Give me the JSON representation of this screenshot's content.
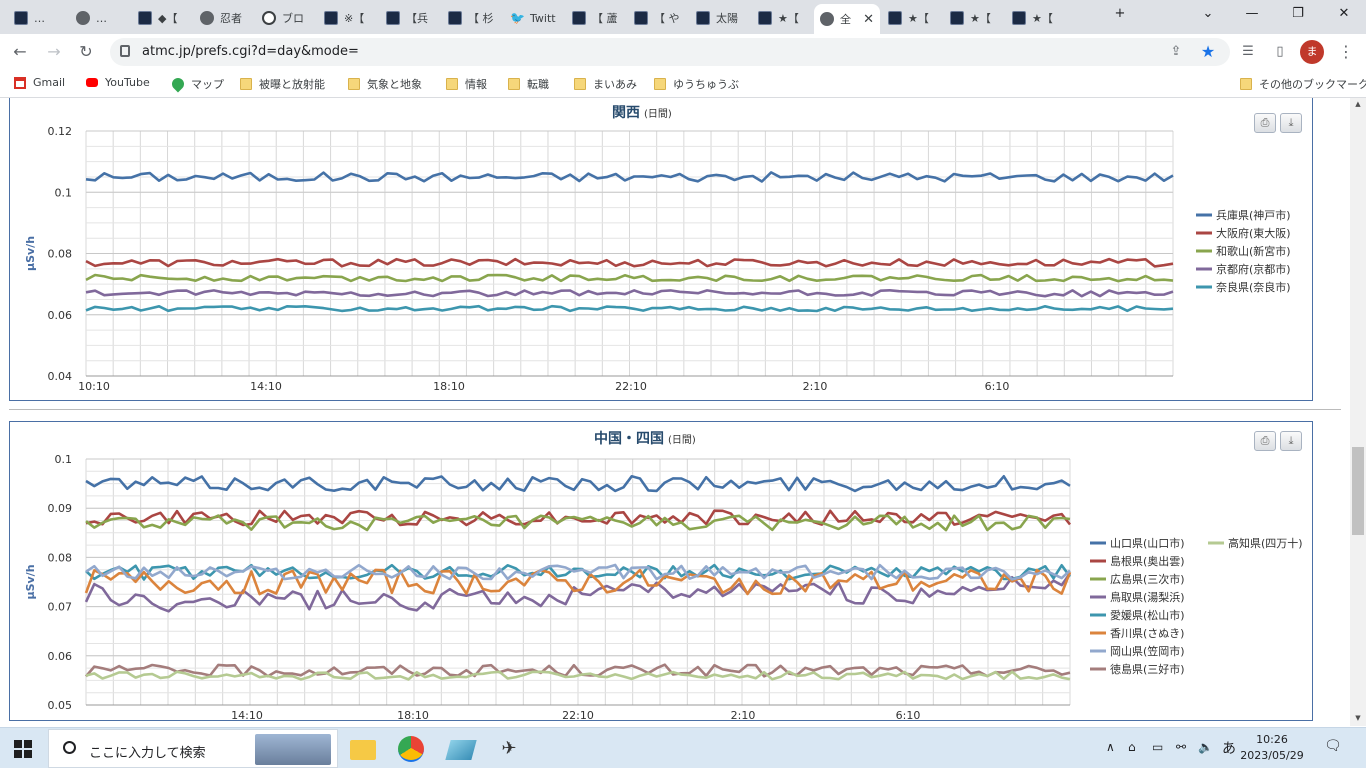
{
  "browser": {
    "tabs": [
      {
        "label": "…",
        "icon": "site-favicon",
        "active": false
      },
      {
        "label": "…",
        "icon": "globe-icon",
        "active": false
      },
      {
        "label": "◆【",
        "icon": "site-favicon",
        "active": false
      },
      {
        "label": "忍者",
        "icon": "globe-icon",
        "active": false
      },
      {
        "label": "ブロ",
        "icon": "circle-icon",
        "active": false
      },
      {
        "label": "※【",
        "icon": "site-favicon",
        "active": false
      },
      {
        "label": "【兵",
        "icon": "site-favicon",
        "active": false
      },
      {
        "label": "【 杉",
        "icon": "site-favicon",
        "active": false
      },
      {
        "label": "Twitt",
        "icon": "twitter-icon",
        "active": false
      },
      {
        "label": "【 蘆",
        "icon": "site-favicon",
        "active": false
      },
      {
        "label": "【 や",
        "icon": "site-favicon",
        "active": false
      },
      {
        "label": "太陽",
        "icon": "site-favicon",
        "active": false
      },
      {
        "label": "★【",
        "icon": "site-favicon",
        "active": false
      },
      {
        "label": "全",
        "icon": "globe-icon",
        "active": true
      },
      {
        "label": "★【",
        "icon": "site-favicon",
        "active": false
      },
      {
        "label": "★【",
        "icon": "site-favicon",
        "active": false
      },
      {
        "label": "★【",
        "icon": "site-favicon",
        "active": false
      }
    ],
    "new_tab": "+",
    "tab_search": "⌄",
    "minimize": "—",
    "maximize": "❐",
    "close": "✕",
    "url": "atmc.jp/prefs.cgi?d=day&mode=",
    "avatar_letter": "ま",
    "bookmarks": [
      {
        "label": "Gmail",
        "icon": "gmail-icon"
      },
      {
        "label": "YouTube",
        "icon": "youtube-icon"
      },
      {
        "label": "マップ",
        "icon": "maps-icon"
      },
      {
        "label": "被曝と放射能",
        "icon": "folder-icon"
      },
      {
        "label": "気象と地象",
        "icon": "folder-icon"
      },
      {
        "label": "情報",
        "icon": "folder-icon"
      },
      {
        "label": "転職",
        "icon": "folder-icon"
      },
      {
        "label": "まいあみ",
        "icon": "folder-icon"
      },
      {
        "label": "ゆうちゅうぶ",
        "icon": "folder-icon"
      }
    ],
    "other_bookmarks": "その他のブックマーク"
  },
  "chart_data": [
    {
      "type": "line",
      "title": "関西",
      "subtitle": "(日間)",
      "ylabel": "μSv/h",
      "ylim": [
        0.04,
        0.12
      ],
      "yticks": [
        "0.12",
        "0.1",
        "0.08",
        "0.06",
        "0.04"
      ],
      "ytick_values": [
        0.12,
        0.1,
        0.08,
        0.06,
        0.04
      ],
      "xlabels": [
        "10:10",
        "14:10",
        "18:10",
        "22:10",
        "2:10",
        "6:10"
      ],
      "n_points": 120,
      "series": [
        {
          "name": "兵庫県(神戸市)",
          "color": "#4572a7",
          "base": 0.105,
          "jitter": 0.0015,
          "walk": false
        },
        {
          "name": "大阪府(東大阪)",
          "color": "#aa4643",
          "base": 0.077,
          "jitter": 0.0012,
          "walk": false
        },
        {
          "name": "和歌山(新宮市)",
          "color": "#89a54e",
          "base": 0.072,
          "jitter": 0.001,
          "walk": false
        },
        {
          "name": "京都府(京都市)",
          "color": "#80699b",
          "base": 0.067,
          "jitter": 0.001,
          "walk": false
        },
        {
          "name": "奈良県(奈良市)",
          "color": "#3d96ae",
          "base": 0.062,
          "jitter": 0.0008,
          "walk": false
        }
      ]
    },
    {
      "type": "line",
      "title": "中国・四国",
      "subtitle": "(日間)",
      "ylabel": "μSv/h",
      "ylim": [
        0.05,
        0.1
      ],
      "yticks": [
        "0.1",
        "0.09",
        "0.08",
        "0.07",
        "0.06",
        "0.05"
      ],
      "ytick_values": [
        0.1,
        0.09,
        0.08,
        0.07,
        0.06,
        0.05
      ],
      "xlabels": [
        "14:10",
        "18:10",
        "22:10",
        "2:10",
        "6:10"
      ],
      "n_points": 120,
      "series": [
        {
          "name": "山口県(山口市)",
          "color": "#4572a7",
          "base": 0.095,
          "jitter": 0.0015,
          "walk": false
        },
        {
          "name": "島根県(奥出雲)",
          "color": "#aa4643",
          "base": 0.088,
          "jitter": 0.0015,
          "walk": false
        },
        {
          "name": "広島県(三次市)",
          "color": "#89a54e",
          "base": 0.087,
          "jitter": 0.0015,
          "walk": false
        },
        {
          "name": "鳥取県(湯梨浜)",
          "color": "#80699b",
          "base": 0.073,
          "jitter": 0.002,
          "walk": true
        },
        {
          "name": "愛媛県(松山市)",
          "color": "#3d96ae",
          "base": 0.077,
          "jitter": 0.0015,
          "walk": false
        },
        {
          "name": "香川県(さぬき)",
          "color": "#db843d",
          "base": 0.075,
          "jitter": 0.0025,
          "walk": false
        },
        {
          "name": "岡山県(笠岡市)",
          "color": "#92a8cd",
          "base": 0.077,
          "jitter": 0.0015,
          "walk": false
        },
        {
          "name": "徳島県(三好市)",
          "color": "#a47d7c",
          "base": 0.057,
          "jitter": 0.0012,
          "walk": false
        },
        {
          "name": "高知県(四万十)",
          "color": "#b5ca92",
          "base": 0.056,
          "jitter": 0.0008,
          "walk": false
        }
      ]
    }
  ],
  "taskbar": {
    "search_placeholder": "ここに入力して検索",
    "time": "10:26",
    "date": "2023/05/29",
    "ime": "あ"
  }
}
